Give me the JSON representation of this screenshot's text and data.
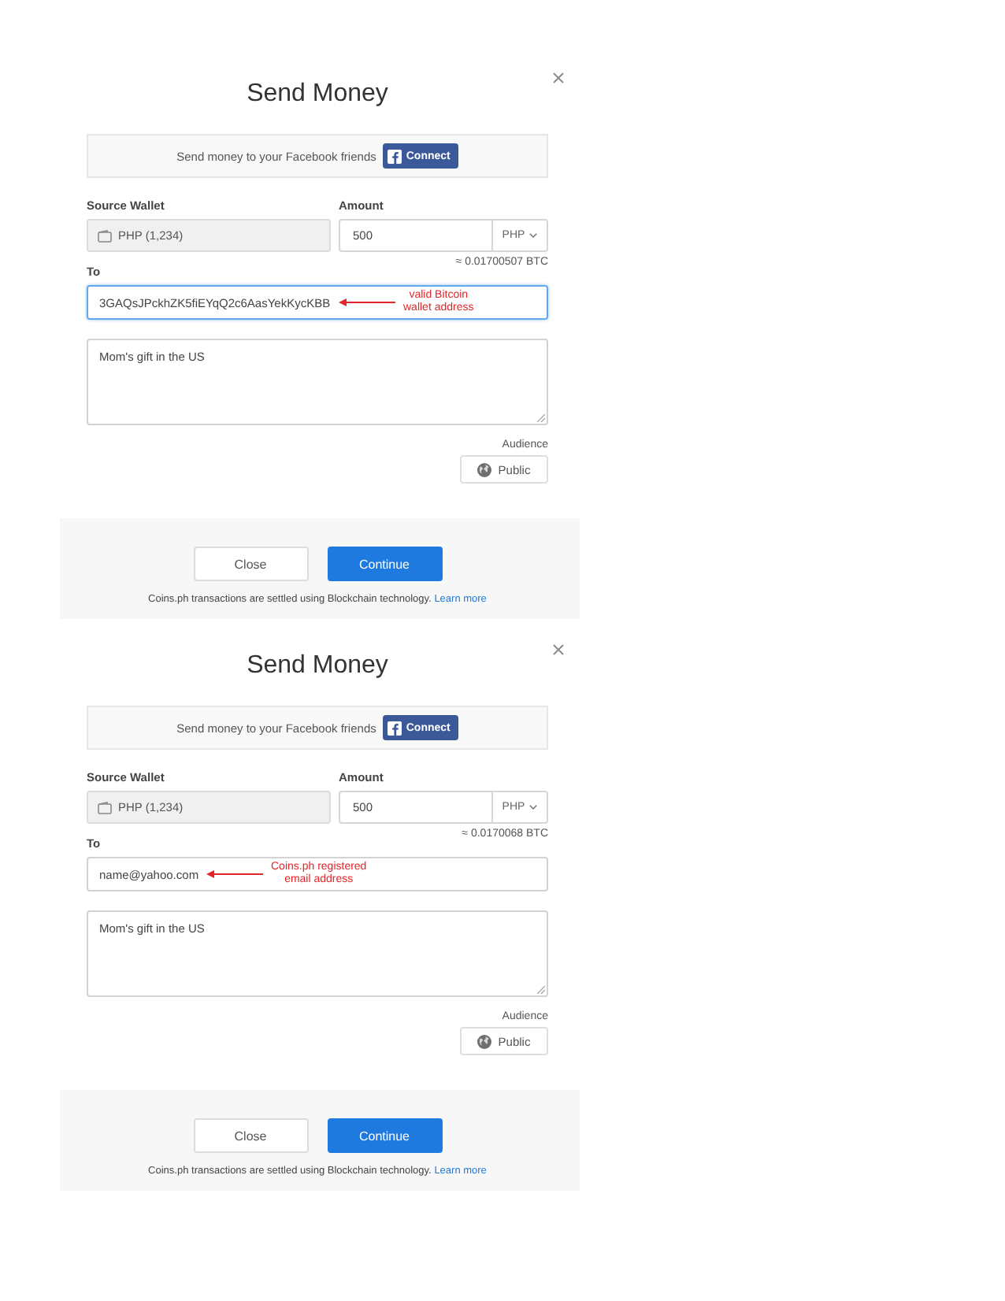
{
  "panels": [
    {
      "title": "Send Money",
      "facebook_banner": {
        "text": "Send money to your Facebook friends",
        "button": "Connect"
      },
      "source_wallet": {
        "label": "Source Wallet",
        "value": "PHP (1,234)"
      },
      "amount": {
        "label": "Amount",
        "value": "500",
        "currency": "PHP",
        "conversion": "≈ 0.01700507 BTC"
      },
      "to": {
        "label": "To",
        "value": "3GAQsJPckhZK5fiEYqQ2c6AasYekKycKBB",
        "focused": true,
        "annotation": "valid Bitcoin\nwallet address"
      },
      "note": {
        "value": "Mom's gift in the US"
      },
      "audience": {
        "label": "Audience",
        "button": "Public"
      },
      "buttons": [
        {
          "label": "Close",
          "kind": "secondary"
        },
        {
          "label": "Continue",
          "kind": "primary"
        }
      ],
      "footnote": {
        "text": "Coins.ph transactions are settled using Blockchain technology.",
        "link": "Learn more"
      }
    },
    {
      "title": "Send Money",
      "facebook_banner": {
        "text": "Send money to your Facebook friends",
        "button": "Connect"
      },
      "source_wallet": {
        "label": "Source Wallet",
        "value": "PHP (1,234)"
      },
      "amount": {
        "label": "Amount",
        "value": "500",
        "currency": "PHP",
        "conversion": "≈ 0.0170068 BTC"
      },
      "to": {
        "label": "To",
        "value": "name@yahoo.com",
        "focused": false,
        "annotation": "Coins.ph registered\nemail address"
      },
      "note": {
        "value": "Mom's gift in the US"
      },
      "audience": {
        "label": "Audience",
        "button": "Public"
      },
      "buttons": [
        {
          "label": "Close",
          "kind": "secondary"
        },
        {
          "label": "Continue",
          "kind": "primary"
        }
      ],
      "footnote": {
        "text": "Coins.ph transactions are settled using Blockchain technology.",
        "link": "Learn more"
      }
    }
  ]
}
